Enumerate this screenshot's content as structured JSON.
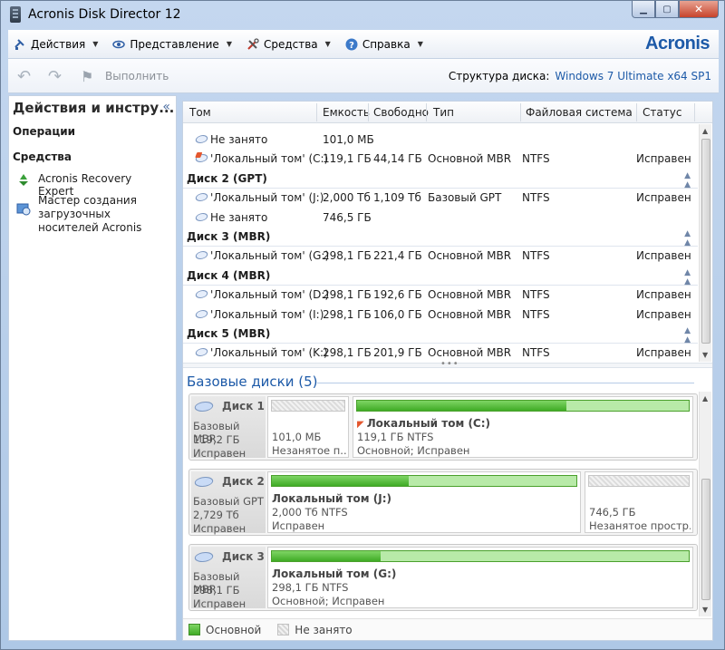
{
  "window": {
    "title": "Acronis Disk Director 12"
  },
  "menu": {
    "items": [
      {
        "label": "Действия",
        "icon": "actions-icon"
      },
      {
        "label": "Представление",
        "icon": "view-icon"
      },
      {
        "label": "Средства",
        "icon": "tools-icon"
      },
      {
        "label": "Справка",
        "icon": "help-icon"
      }
    ],
    "brand": "Acronis"
  },
  "toolbar": {
    "execute_label": "Выполнить",
    "disk_structure_label": "Структура диска:",
    "disk_structure_value": "Windows 7 Ultimate x64 SP1"
  },
  "left_panel": {
    "title": "Действия и инстру...",
    "operations": "Операции",
    "tools": "Средства",
    "items": [
      {
        "label": "Acronis Recovery Expert"
      },
      {
        "label": "Мастер создания загрузочных носителей Acronis"
      }
    ]
  },
  "table": {
    "headers": [
      "Том",
      "Емкость",
      "Свободно",
      "Тип",
      "Файловая система",
      "Статус"
    ],
    "rows": [
      {
        "kind": "vol",
        "name": "Не занято",
        "capacity": "101,0 МБ",
        "free": "",
        "type": "",
        "fs": "",
        "status": ""
      },
      {
        "kind": "vol",
        "sys": true,
        "name": "'Локальный том' (C:)",
        "capacity": "119,1 ГБ",
        "free": "44,14 ГБ",
        "type": "Основной MBR",
        "fs": "NTFS",
        "status": "Исправен"
      },
      {
        "kind": "disk",
        "name": "Диск 2 (GPT)"
      },
      {
        "kind": "vol",
        "name": "'Локальный том' (J:)",
        "capacity": "2,000 Тб",
        "free": "1,109 Тб",
        "type": "Базовый GPT",
        "fs": "NTFS",
        "status": "Исправен"
      },
      {
        "kind": "vol",
        "name": "Не занято",
        "capacity": "746,5 ГБ",
        "free": "",
        "type": "",
        "fs": "",
        "status": ""
      },
      {
        "kind": "disk",
        "name": "Диск 3 (MBR)"
      },
      {
        "kind": "vol",
        "name": "'Локальный том' (G:)",
        "capacity": "298,1 ГБ",
        "free": "221,4 ГБ",
        "type": "Основной MBR",
        "fs": "NTFS",
        "status": "Исправен"
      },
      {
        "kind": "disk",
        "name": "Диск 4 (MBR)"
      },
      {
        "kind": "vol",
        "name": "'Локальный том' (D:)",
        "capacity": "298,1 ГБ",
        "free": "192,6 ГБ",
        "type": "Основной MBR",
        "fs": "NTFS",
        "status": "Исправен"
      },
      {
        "kind": "vol",
        "name": "'Локальный том' (I:)",
        "capacity": "298,1 ГБ",
        "free": "106,0 ГБ",
        "type": "Основной MBR",
        "fs": "NTFS",
        "status": "Исправен"
      },
      {
        "kind": "disk",
        "name": "Диск 5 (MBR)"
      },
      {
        "kind": "vol",
        "name": "'Локальный том' (K:)",
        "capacity": "298,1 ГБ",
        "free": "201,9 ГБ",
        "type": "Основной MBR",
        "fs": "NTFS",
        "status": "Исправен"
      }
    ]
  },
  "basic_disks": {
    "title": "Базовые диски (5)",
    "disks": [
      {
        "name": "Диск 1",
        "type": "Базовый MBR",
        "size": "119,2 ГБ",
        "status": "Исправен",
        "partitions": [
          {
            "empty": true,
            "title": "",
            "line2": "101,0 МБ",
            "line3": "Незанятое п...",
            "used": 0
          },
          {
            "empty": false,
            "sys": true,
            "title": "Локальный том (C:)",
            "line2": "119,1 ГБ NTFS",
            "line3": "Основной; Исправен",
            "used": 0.63
          }
        ]
      },
      {
        "name": "Диск 2",
        "type": "Базовый GPT",
        "size": "2,729 Тб",
        "status": "Исправен",
        "partitions": [
          {
            "empty": false,
            "title": "Локальный том (J:)",
            "line2": "2,000 Тб NTFS",
            "line3": "Исправен",
            "used": 0.45
          },
          {
            "empty": true,
            "title": "",
            "line2": "746,5 ГБ",
            "line3": "Незанятое простр...",
            "used": 0
          }
        ]
      },
      {
        "name": "Диск 3",
        "type": "Базовый MBR",
        "size": "298,1 ГБ",
        "status": "Исправен",
        "partitions": [
          {
            "empty": false,
            "title": "Локальный том (G:)",
            "line2": "298,1 ГБ NTFS",
            "line3": "Основной; Исправен",
            "used": 0.26
          }
        ]
      }
    ]
  },
  "legend": {
    "primary": "Основной",
    "unallocated": "Не занято"
  }
}
